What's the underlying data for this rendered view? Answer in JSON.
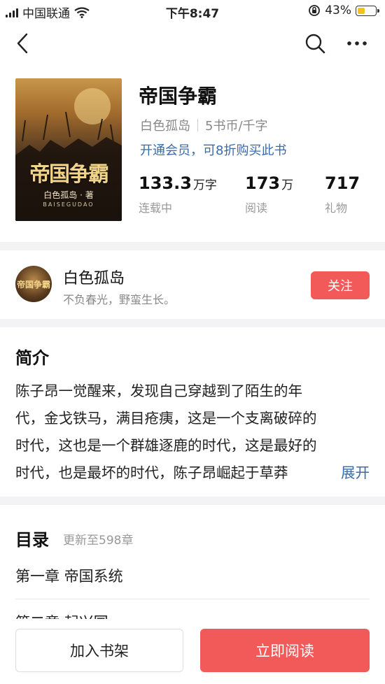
{
  "status_bar": {
    "carrier": "中国联通",
    "time": "下午8:47",
    "battery_pct": "43%",
    "battery_level": 0.43,
    "battery_color": "#f4c21a"
  },
  "nav": {
    "back_icon": "chevron-left-icon",
    "search_icon": "search-icon",
    "more_icon": "more-dots-icon"
  },
  "book": {
    "title": "帝国争霸",
    "author": "白色孤岛",
    "price": "5书币/千字",
    "vip_offer": "开通会员，可8折购买此书",
    "cover": {
      "title_text": "帝国争霸",
      "author_text": "白色孤岛 · 著",
      "pinyin_text": "BAISEGUDAO"
    },
    "stats": [
      {
        "value": "133.3",
        "unit": "万字",
        "label": "连载中"
      },
      {
        "value": "173",
        "unit": "万",
        "label": "阅读"
      },
      {
        "value": "717",
        "unit": "",
        "label": "礼物"
      }
    ]
  },
  "author_card": {
    "name": "白色孤岛",
    "motto": "不负春光，野蛮生长。",
    "follow_label": "关注",
    "avatar_text": "帝国争霸"
  },
  "intro": {
    "title": "简介",
    "lines": [
      "陈子昂一觉醒来，发现自己穿越到了陌生的年",
      "代，金戈铁马，满目疮痍，这是一个支离破碎的",
      "时代，这也是一个群雄逐鹿的时代，这是最好的",
      "时代，也是最坏的时代，陈子昂崛起于草莽"
    ],
    "expand_label": "展开"
  },
  "contents": {
    "title": "目录",
    "update_note": "更新至598章",
    "chapters": [
      "第一章 帝国系统",
      "第二章 起兴国"
    ]
  },
  "bottom_bar": {
    "add_shelf_label": "加入书架",
    "read_now_label": "立即阅读"
  },
  "colors": {
    "accent_red": "#f25a5a",
    "link_blue": "#3b6aa9"
  }
}
